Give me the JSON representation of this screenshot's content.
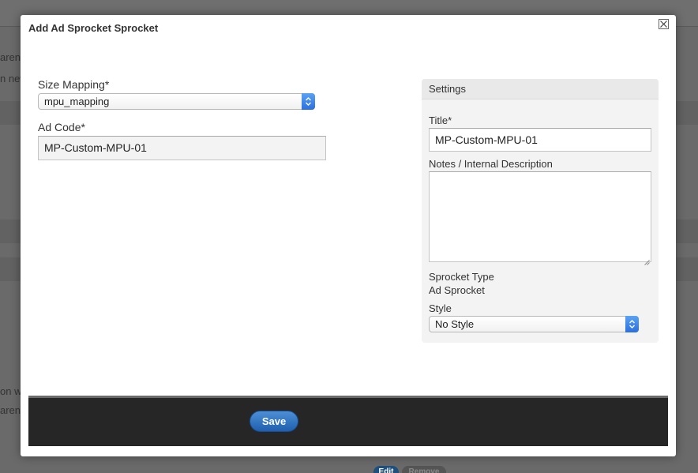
{
  "background": {
    "fragments": [
      "aren",
      "n new",
      "on w",
      "aren"
    ],
    "edit_label": "Edit",
    "remove_label": "Remove"
  },
  "modal": {
    "title": "Add Ad Sprocket Sprocket",
    "close_icon": "close-icon"
  },
  "form": {
    "size_mapping_label": "Size Mapping*",
    "size_mapping_value": "mpu_mapping",
    "ad_code_label": "Ad Code*",
    "ad_code_value": "MP-Custom-MPU-01"
  },
  "settings": {
    "header": "Settings",
    "title_label": "Title*",
    "title_value": "MP-Custom-MPU-01",
    "notes_label": "Notes / Internal Description",
    "notes_value": "",
    "sprocket_type_label": "Sprocket Type",
    "sprocket_type_value": "Ad Sprocket",
    "style_label": "Style",
    "style_value": "No Style"
  },
  "footer": {
    "save_label": "Save"
  },
  "colors": {
    "accent": "#2b6fe0",
    "save_button": "#2a6ab8",
    "footer_bg": "#262626",
    "overlay": "#6a6a6a"
  }
}
